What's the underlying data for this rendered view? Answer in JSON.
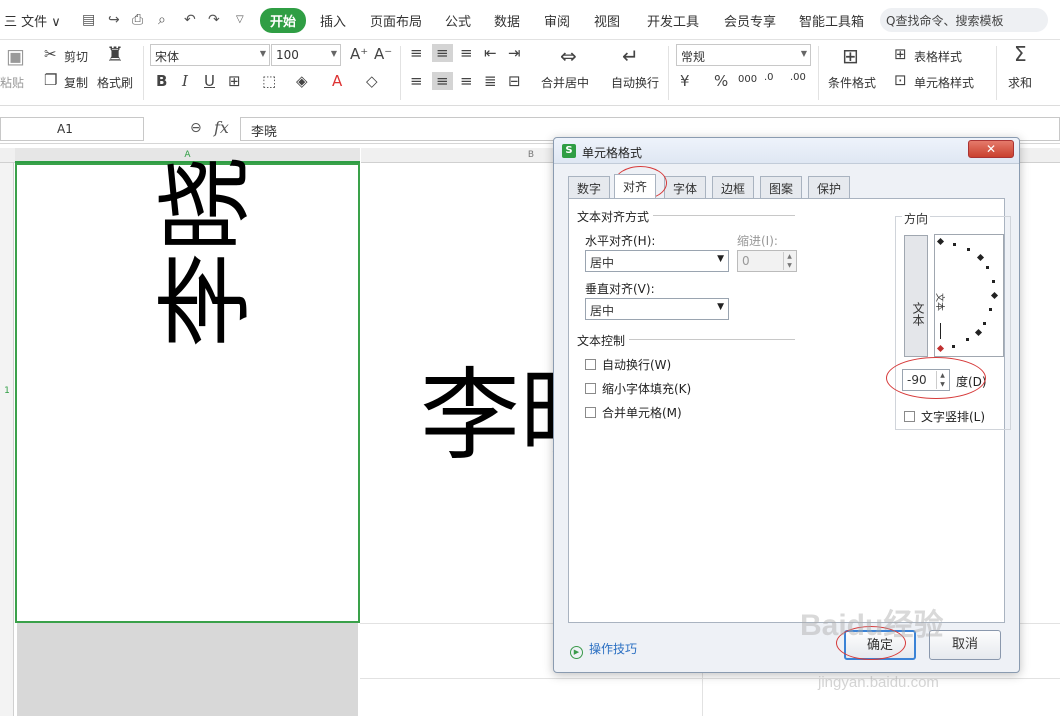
{
  "menubar": {
    "file_label": "三 文件 ∨",
    "tabs": [
      "开始",
      "插入",
      "页面布局",
      "公式",
      "数据",
      "审阅",
      "视图",
      "开发工具",
      "会员专享",
      "智能工具箱"
    ],
    "search_placeholder": "Q查找命令、搜索模板"
  },
  "ribbon": {
    "paste": "粘贴",
    "cut": "剪切",
    "copy": "复制",
    "format_painter": "格式刷",
    "font": "宋体",
    "size": "100",
    "merge": "合并居中",
    "wrap": "自动换行",
    "numfmt": "常规",
    "cond_format": "条件格式",
    "table_style": "表格样式",
    "cell_style": "单元格样式",
    "sum": "求和"
  },
  "formula": {
    "name_box": "A1",
    "content": "李晓"
  },
  "sheet": {
    "col_a": "A",
    "col_b": "B",
    "row_1": "1",
    "cell_a1_text": "李晓",
    "cell_b1_text": "李晓"
  },
  "dialog": {
    "title": "单元格格式",
    "close": "✕",
    "tabs": [
      "数字",
      "对齐",
      "字体",
      "边框",
      "图案",
      "保护"
    ],
    "active_tab": "对齐",
    "text_align_section": "文本对齐方式",
    "horizontal_label": "水平对齐(H):",
    "horizontal_value": "居中",
    "indent_label": "缩进(I):",
    "indent_value": "0",
    "vertical_label": "垂直对齐(V):",
    "vertical_value": "居中",
    "text_control_section": "文本控制",
    "wrap_text": "自动换行(W)",
    "shrink_fit": "缩小字体填充(K)",
    "merge_cells": "合并单元格(M)",
    "orientation_section": "方向",
    "vertical_text_button": "文本",
    "dial_text": "文本",
    "degree_value": "-90",
    "degree_label": "度(D)",
    "vertical_stack": "文字竖排(L)",
    "tips": "操作技巧",
    "ok": "确定",
    "cancel": "取消"
  },
  "watermark": {
    "main": "Baidu经验",
    "sub": "jingyan.baidu.com"
  },
  "colors": {
    "accent_green": "#2f9e44",
    "annotation_red": "#d63a3a",
    "primary_blue": "#3b83d6"
  }
}
